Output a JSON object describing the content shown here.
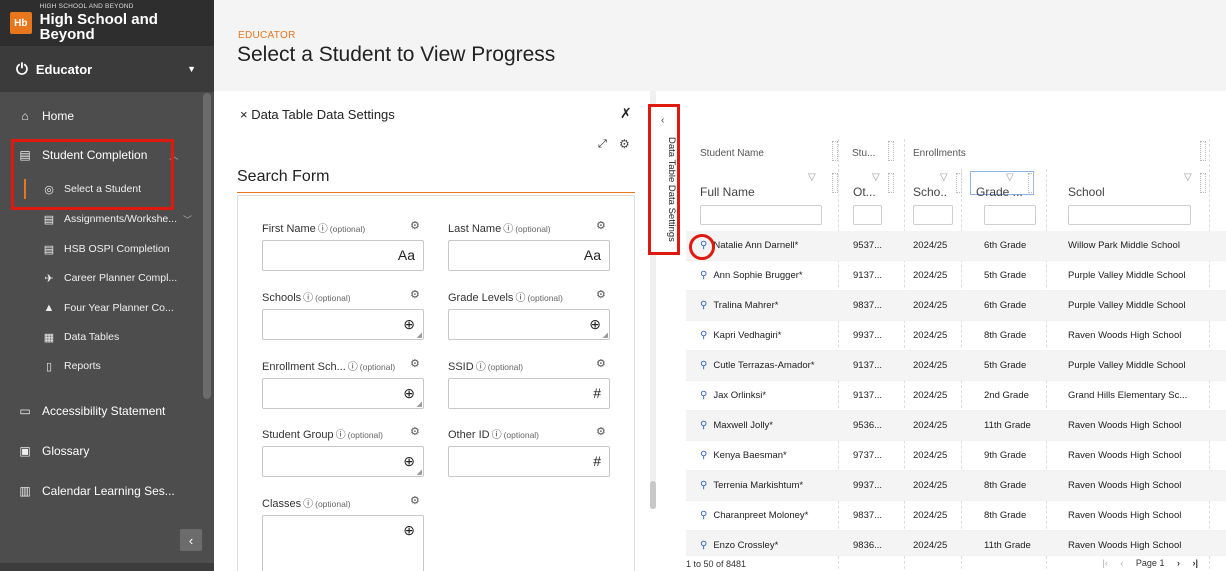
{
  "brand": {
    "logo": "Hb",
    "small": "HIGH SCHOOL AND BEYOND",
    "big": "High School and Beyond"
  },
  "role": {
    "label": "Educator",
    "icon": "power-icon"
  },
  "nav": {
    "home": "Home",
    "student_completion": "Student Completion",
    "select_student": "Select a Student",
    "assignments": "Assignments/Workshe...",
    "ospi": "HSB OSPI Completion",
    "career": "Career Planner Compl...",
    "four_year": "Four Year Planner Co...",
    "data_tables": "Data Tables",
    "reports": "Reports",
    "accessibility": "Accessibility Statement",
    "glossary": "Glossary",
    "calendar": "Calendar Learning Ses..."
  },
  "header": {
    "eyebrow": "EDUCATOR",
    "title": "Select a Student to View Progress"
  },
  "settings": {
    "title": "× Data Table Data Settings",
    "search_title": "Search Form",
    "vertical_tab": "Data Table Data Settings",
    "fields": {
      "first_name": {
        "label": "First Name",
        "optional": "(optional)",
        "glyph": "Aa"
      },
      "last_name": {
        "label": "Last Name",
        "optional": "(optional)",
        "glyph": "Aa"
      },
      "schools": {
        "label": "Schools",
        "optional": "(optional)",
        "glyph": "⊕"
      },
      "grade_levels": {
        "label": "Grade Levels",
        "optional": "(optional)",
        "glyph": "⊕"
      },
      "enrollment": {
        "label": "Enrollment Sch...",
        "optional": "(optional)",
        "glyph": "⊕"
      },
      "ssid": {
        "label": "SSID",
        "optional": "(optional)",
        "glyph": "#"
      },
      "student_group": {
        "label": "Student Group",
        "optional": "(optional)",
        "glyph": "⊕"
      },
      "other_id": {
        "label": "Other ID",
        "optional": "(optional)",
        "glyph": "#"
      },
      "classes": {
        "label": "Classes",
        "optional": "(optional)",
        "glyph": "⊕"
      }
    }
  },
  "grid": {
    "group_headers": {
      "student_name": "Student Name",
      "stu": "Stu...",
      "enrollments": "Enrollments"
    },
    "columns": {
      "full_name": "Full Name",
      "ot": "Ot...",
      "scho": "Scho...",
      "grade": "Grade ...",
      "school": "School"
    },
    "rows": [
      {
        "name": "Natalie Ann Darnell*",
        "id": "9537...",
        "year": "2024/25",
        "grade": "6th Grade",
        "school": "Willow Park Middle School"
      },
      {
        "name": "Ann Sophie Brugger*",
        "id": "9137...",
        "year": "2024/25",
        "grade": "5th Grade",
        "school": "Purple Valley Middle School"
      },
      {
        "name": "Tralina Mahrer*",
        "id": "9837...",
        "year": "2024/25",
        "grade": "6th Grade",
        "school": "Purple Valley Middle School"
      },
      {
        "name": "Kapri Vedhagiri*",
        "id": "9937...",
        "year": "2024/25",
        "grade": "8th Grade",
        "school": "Raven Woods High School"
      },
      {
        "name": "Cutle Terrazas-Amador*",
        "id": "9137...",
        "year": "2024/25",
        "grade": "5th Grade",
        "school": "Purple Valley Middle School"
      },
      {
        "name": "Jax Orlinksi*",
        "id": "9137...",
        "year": "2024/25",
        "grade": "2nd Grade",
        "school": "Grand Hills Elementary Sc..."
      },
      {
        "name": "Maxwell Jolly*",
        "id": "9536...",
        "year": "2024/25",
        "grade": "11th Grade",
        "school": "Raven Woods High School"
      },
      {
        "name": "Kenya Baesman*",
        "id": "9737...",
        "year": "2024/25",
        "grade": "9th Grade",
        "school": "Raven Woods High School"
      },
      {
        "name": "Terrenia Markishtum*",
        "id": "9937...",
        "year": "2024/25",
        "grade": "8th Grade",
        "school": "Raven Woods High School"
      },
      {
        "name": "Charanpreet Moloney*",
        "id": "9837...",
        "year": "2024/25",
        "grade": "8th Grade",
        "school": "Raven Woods High School"
      },
      {
        "name": "Enzo Crossley*",
        "id": "9836...",
        "year": "2024/25",
        "grade": "11th Grade",
        "school": "Raven Woods High School"
      }
    ],
    "footer": {
      "range": "1 to 50 of 8481",
      "page": "Page 1"
    }
  },
  "colors": {
    "accent": "#e8761c",
    "sidebar": "#4d4d4d",
    "highlight": "#e0190f",
    "link": "#2f63c4"
  }
}
